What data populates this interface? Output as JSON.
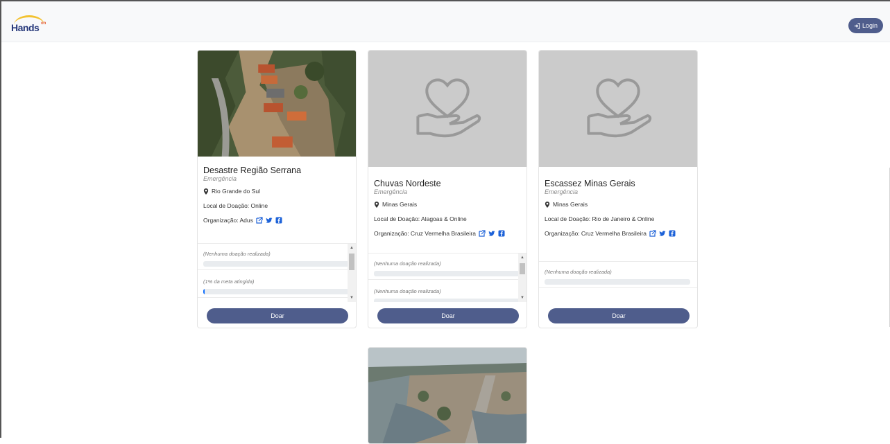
{
  "nav": {
    "brand": "Hands",
    "brand_sup": "on",
    "login_label": "Login"
  },
  "cards": [
    {
      "title": "Desastre Região Serrana",
      "category": "Emergência",
      "location": "Rio Grande do Sul",
      "donation_place": "Local de Doação: Online",
      "organization": "Organização: Adus",
      "progress": [
        {
          "label": "(Nenhuma doação realizada)",
          "percent": 0
        },
        {
          "label": "(1% da meta atingida)",
          "percent": 1
        }
      ],
      "donate_label": "Doar"
    },
    {
      "title": "Chuvas Nordeste",
      "category": "Emergência",
      "location": "Minas Gerais",
      "donation_place": "Local de Doação: Alagoas & Online",
      "organization": "Organização: Cruz Vermelha Brasileira",
      "progress": [
        {
          "label": "(Nenhuma doação realizada)",
          "percent": 0
        },
        {
          "label": "(Nenhuma doação realizada)",
          "percent": 0
        }
      ],
      "donate_label": "Doar"
    },
    {
      "title": "Escassez Minas Gerais",
      "category": "Emergência",
      "location": "Minas Gerais",
      "donation_place": "Local de Doação: Rio de Janeiro & Online",
      "organization": "Organização: Cruz Vermelha Brasileira",
      "progress": [
        {
          "label": "(Nenhuma doação realizada)",
          "percent": 0
        }
      ],
      "donate_label": "Doar"
    }
  ],
  "colors": {
    "primary": "#4f5d8c",
    "progress_fill": "#0d6efd",
    "placeholder": "#cbcbcb"
  }
}
